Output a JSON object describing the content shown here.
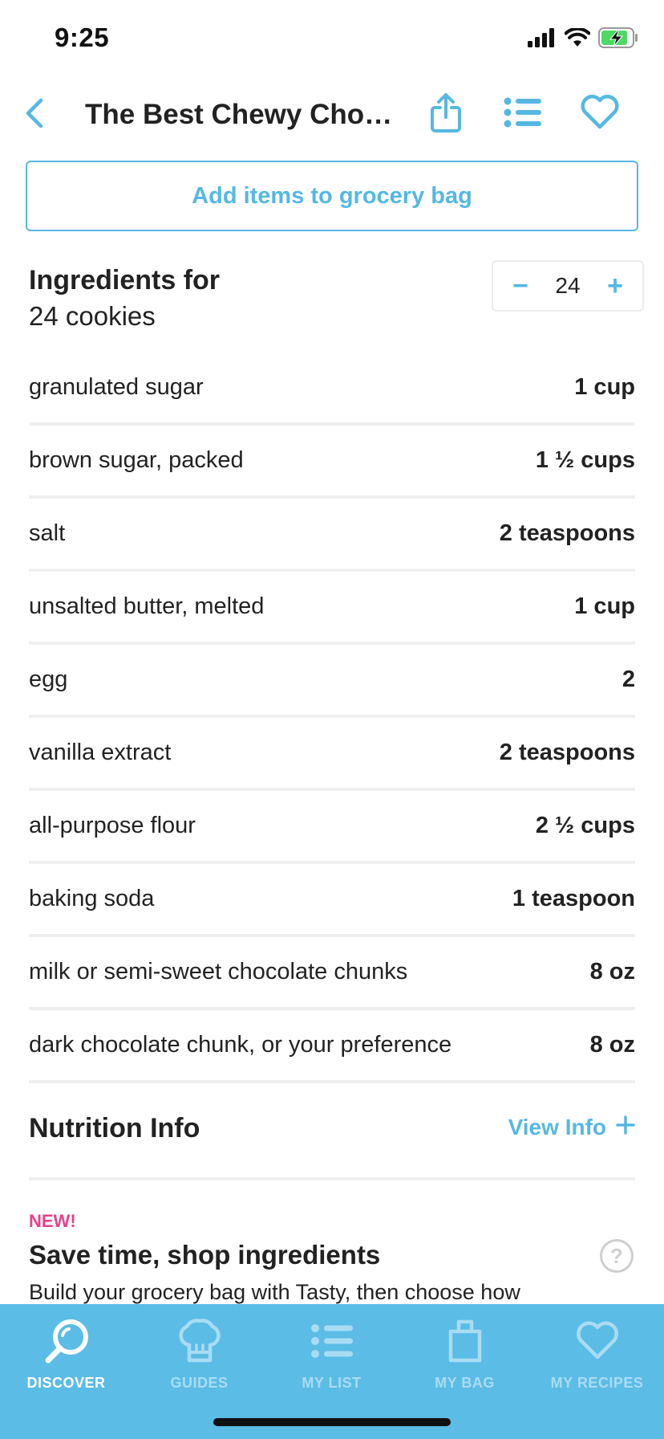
{
  "status_bar": {
    "time": "9:25"
  },
  "nav": {
    "title": "The Best Chewy Choc...",
    "icons": [
      "back-chevron-icon",
      "share-icon",
      "list-icon",
      "heart-icon"
    ]
  },
  "grocery_button": {
    "label": "Add items to grocery bag"
  },
  "ingredients": {
    "heading": "Ingredients for",
    "subheading": "24 cookies",
    "servings_value": "24",
    "decrement_symbol": "−",
    "increment_symbol": "+",
    "items": [
      {
        "name": "granulated sugar",
        "amount": "1 cup"
      },
      {
        "name": "brown sugar, packed",
        "amount": "1 ½ cups"
      },
      {
        "name": "salt",
        "amount": "2 teaspoons"
      },
      {
        "name": "unsalted butter, melted",
        "amount": "1 cup"
      },
      {
        "name": "egg",
        "amount": "2"
      },
      {
        "name": "vanilla extract",
        "amount": "2 teaspoons"
      },
      {
        "name": "all-purpose flour",
        "amount": "2 ½ cups"
      },
      {
        "name": "baking soda",
        "amount": "1 teaspoon"
      },
      {
        "name": "milk or semi-sweet chocolate chunks",
        "amount": "8 oz"
      },
      {
        "name": "dark chocolate chunk, or your preference",
        "amount": "8 oz"
      }
    ]
  },
  "nutrition": {
    "title": "Nutrition Info",
    "link_label": "View Info"
  },
  "promo": {
    "badge": "NEW!",
    "title": "Save time, shop ingredients",
    "description": "Build your grocery bag with Tasty, then choose how",
    "help_symbol": "?"
  },
  "tab_bar": {
    "tabs": [
      {
        "label": "DISCOVER",
        "icon": "search-icon",
        "active": true
      },
      {
        "label": "GUIDES",
        "icon": "chef-hat-icon",
        "active": false
      },
      {
        "label": "MY LIST",
        "icon": "list-icon",
        "active": false
      },
      {
        "label": "MY BAG",
        "icon": "bag-icon",
        "active": false
      },
      {
        "label": "MY RECIPES",
        "icon": "heart-icon",
        "active": false
      }
    ]
  },
  "colors": {
    "accent": "#55b8e3",
    "tab_bar_bg": "#5bbce6",
    "new_badge": "#e8418a",
    "divider": "#efefef"
  }
}
